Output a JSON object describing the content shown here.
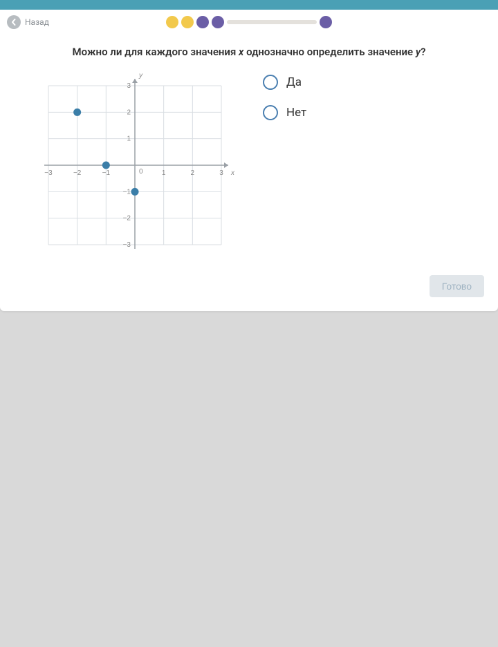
{
  "nav": {
    "back_label": "Назад"
  },
  "progress": {
    "dots": [
      "yellow",
      "yellow",
      "purple",
      "purple",
      "bar",
      "purple"
    ]
  },
  "question": {
    "prefix": "Можно ли для каждого значения ",
    "xvar": "x",
    "middle": " однозначно определить значение ",
    "yvar": "y",
    "suffix": "?"
  },
  "options": {
    "yes": "Да",
    "no": "Нет"
  },
  "submit": "Готово",
  "chart_data": {
    "type": "scatter",
    "title": "",
    "xlabel": "x",
    "ylabel": "y",
    "xlim": [
      -3,
      3
    ],
    "ylim": [
      -3,
      3
    ],
    "xticks": [
      -3,
      -2,
      -1,
      0,
      1,
      2,
      3
    ],
    "yticks": [
      -3,
      -2,
      -1,
      1,
      2,
      3
    ],
    "points": [
      {
        "x": -2,
        "y": 2
      },
      {
        "x": -1,
        "y": 0
      },
      {
        "x": 0,
        "y": -1
      }
    ],
    "grid": true
  }
}
